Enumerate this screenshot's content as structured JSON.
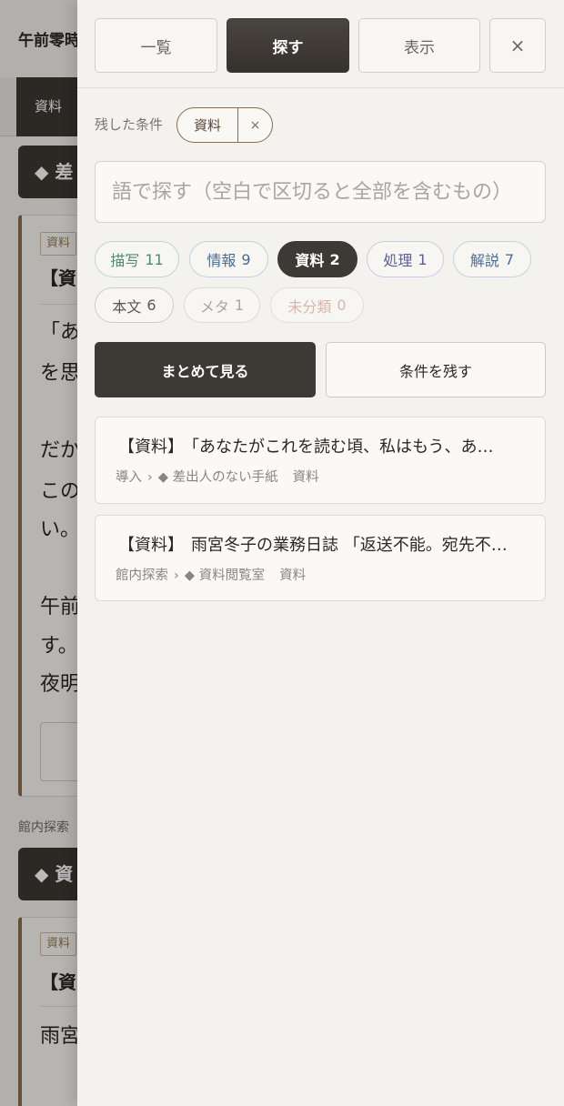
{
  "background_page": {
    "title": "午前零時",
    "tab_label": "資料",
    "section_button_1": "◆ 差",
    "card_1": {
      "tag": "資料",
      "heading": "【資",
      "lines": [
        "「あ",
        "を思",
        "だか",
        "この",
        "い。",
        "午前",
        "す。",
        "夜明"
      ]
    },
    "section_label_2": "館内探索",
    "section_button_2": "◆ 資",
    "card_2": {
      "tag": "資料",
      "heading": "【資",
      "lines": [
        "雨宮"
      ]
    }
  },
  "panel": {
    "tabs": [
      {
        "label": "一覧",
        "active": false
      },
      {
        "label": "探す",
        "active": true
      },
      {
        "label": "表示",
        "active": false
      }
    ],
    "close_label": "×",
    "saved_conditions": {
      "label": "残した条件",
      "chips": [
        {
          "label": "資料",
          "remove_label": "×"
        }
      ]
    },
    "search": {
      "placeholder": "語で探す（空白で区切ると全部を含むもの）"
    },
    "filters": [
      {
        "label": "描写",
        "count": 11,
        "active": false,
        "text_color": "#4f8a6c",
        "border_color": "#bcd8c8"
      },
      {
        "label": "情報",
        "count": 9,
        "active": false,
        "text_color": "#4b6b91",
        "border_color": "#c2d0e3"
      },
      {
        "label": "資料",
        "count": 2,
        "active": true,
        "text_color": "#ffffff",
        "border_color": "#3d3934",
        "bg_color": "#3d3934"
      },
      {
        "label": "処理",
        "count": 1,
        "active": false,
        "text_color": "#5c5f96",
        "border_color": "#cacbe5"
      },
      {
        "label": "解説",
        "count": 7,
        "active": false,
        "text_color": "#4d6e94",
        "border_color": "#c3d1e3"
      },
      {
        "label": "本文",
        "count": 6,
        "active": false,
        "text_color": "#5b5751",
        "border_color": "#cfcbc5"
      },
      {
        "label": "メタ",
        "count": 1,
        "active": false,
        "text_color": "#aaa6a0",
        "border_color": "#ddd9d3"
      },
      {
        "label": "未分類",
        "count": 0,
        "active": false,
        "text_color": "#d8b6b0",
        "border_color": "#eddad6"
      }
    ],
    "actions": {
      "view_together": "まとめて見る",
      "save_conditions": "条件を残す"
    },
    "results": [
      {
        "tag": "【資料】",
        "title": "「あなたがこれを読む頃、私はもう、あ…",
        "path_root": "導入",
        "separator": "›",
        "location": "◆ 差出人のない手紙",
        "type": "資料"
      },
      {
        "tag": "【資料】",
        "title": "雨宮冬子の業務日誌 「返送不能。宛先不…",
        "path_root": "館内探索",
        "separator": "›",
        "location": "◆ 資料閲覧室",
        "type": "資料"
      }
    ]
  },
  "colors": {
    "page_bg": "#f4f2ee",
    "panel_bg": "#f3f2ef",
    "dark": "#3d3934",
    "on_dark": "#ffffff",
    "accent_brown": "#8b6d4c",
    "muted_text": "#8a867f"
  }
}
